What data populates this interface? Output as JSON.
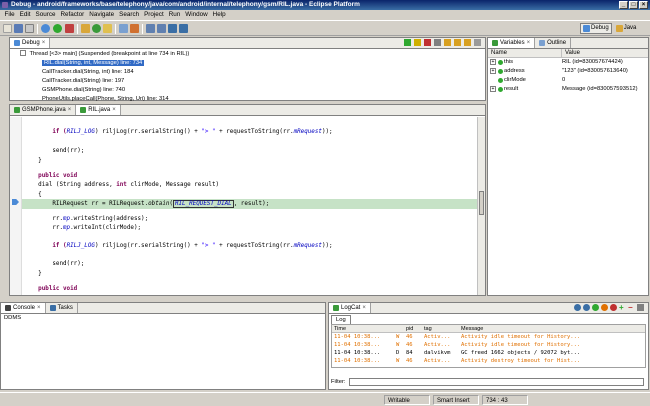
{
  "window": {
    "title": "Debug - android/frameworks/base/telephony/java/com/android/internal/telephony/gsm/RIL.java - Eclipse Platform"
  },
  "menu": [
    "File",
    "Edit",
    "Source",
    "Refactor",
    "Navigate",
    "Search",
    "Project",
    "Run",
    "Window",
    "Help"
  ],
  "perspectives": {
    "debug": "Debug",
    "java": "Java"
  },
  "debug_view": {
    "tab": "Debug",
    "thread": "Thread [<3> main] (Suspended (breakpoint at line 734 in RIL))",
    "frames": [
      "RIL.dial(String, int, Message) line: 734",
      "CallTracker.dial(String, int) line: 184",
      "CallTracker.dial(String) line: 197",
      "GSMPhone.dial(String) line: 740",
      "PhoneUtils.placeCall(Phone, String, Uri) line: 314"
    ]
  },
  "variables_view": {
    "tabs": {
      "variables": "Variables",
      "outline": "Outline"
    },
    "columns": {
      "name": "Name",
      "value": "Value"
    },
    "rows": [
      {
        "name": "this",
        "value": "RIL (id=830057674424)",
        "expandable": true
      },
      {
        "name": "address",
        "value": "\"123\" (id=830057613640)",
        "expandable": true
      },
      {
        "name": "clirMode",
        "value": "0",
        "expandable": false
      },
      {
        "name": "result",
        "value": "Message (id=830057593512)",
        "expandable": true
      }
    ]
  },
  "editor": {
    "tabs": {
      "gsmphone": "GSMPhone.java",
      "ril": "RIL.java"
    },
    "lines": {
      "l1_a": "        if (",
      "l1_b": "RILJ_LOG",
      "l1_c": ") riljLog(rr.serialString() + ",
      "l1_d": "\"> \"",
      "l1_e": " + requestToString(rr.",
      "l1_f": "mRequest",
      "l1_g": "));",
      "l2": "        send(rr);",
      "l3": "    }",
      "l4_kw": "    public void",
      "l5_a": "    dial (String address, ",
      "l5_kw": "int",
      "l5_b": " clirMode, Message result)",
      "l6": "    {",
      "l7_a": "        RILRequest rr = RILRequest.",
      "l7_b": "obtain",
      "l7_c": "(",
      "l7_d": "RIL_REQUEST_DIAL",
      "l7_e": ", result);",
      "l8_a": "        rr.",
      "l8_b": "mp",
      "l8_c": ".writeString(address);",
      "l9_a": "        rr.",
      "l9_b": "mp",
      "l9_c": ".writeInt(clirMode);",
      "l10_a": "        if (",
      "l10_b": "RILJ_LOG",
      "l10_c": ") riljLog(rr.serialString() + ",
      "l10_d": "\"> \"",
      "l10_e": " + requestToString(rr.",
      "l10_f": "mRequest",
      "l10_g": "));",
      "l11": "        send(rr);",
      "l12": "    }",
      "l13_kw": "    public void"
    }
  },
  "console": {
    "tabs": {
      "console": "Console",
      "tasks": "Tasks"
    },
    "text": "DDMS"
  },
  "logcat": {
    "tab": "LogCat",
    "subtab": "Log",
    "columns": [
      "Time",
      "",
      "pid",
      "tag",
      "Message"
    ],
    "rows": [
      {
        "time": "11-04 10:38...",
        "level": "W",
        "pid": "46",
        "tag": "Activ...",
        "message": "Activity idle timeout for History...",
        "kind": "warn"
      },
      {
        "time": "11-04 10:38...",
        "level": "W",
        "pid": "46",
        "tag": "Activ...",
        "message": "Activity idle timeout for History...",
        "kind": "warn"
      },
      {
        "time": "11-04 10:38...",
        "level": "D",
        "pid": "84",
        "tag": "dalvikvm",
        "message": "GC freed 1662 objects / 92072 byt...",
        "kind": "debug"
      },
      {
        "time": "11-04 10:38...",
        "level": "W",
        "pid": "46",
        "tag": "Activ...",
        "message": "Activity destroy timeout for Hist...",
        "kind": "warn"
      }
    ],
    "filter_label": "Filter:"
  },
  "status": {
    "writable": "Writable",
    "insert": "Smart Insert",
    "position": "734 : 43"
  },
  "colors": {
    "title_bar": "#0a246a",
    "selection": "#316ac5",
    "keyword": "#7f0055",
    "field": "#0000c0",
    "string": "#2a00ff",
    "current_line": "#c6e2c6",
    "logcat_warn": "#e07000"
  }
}
